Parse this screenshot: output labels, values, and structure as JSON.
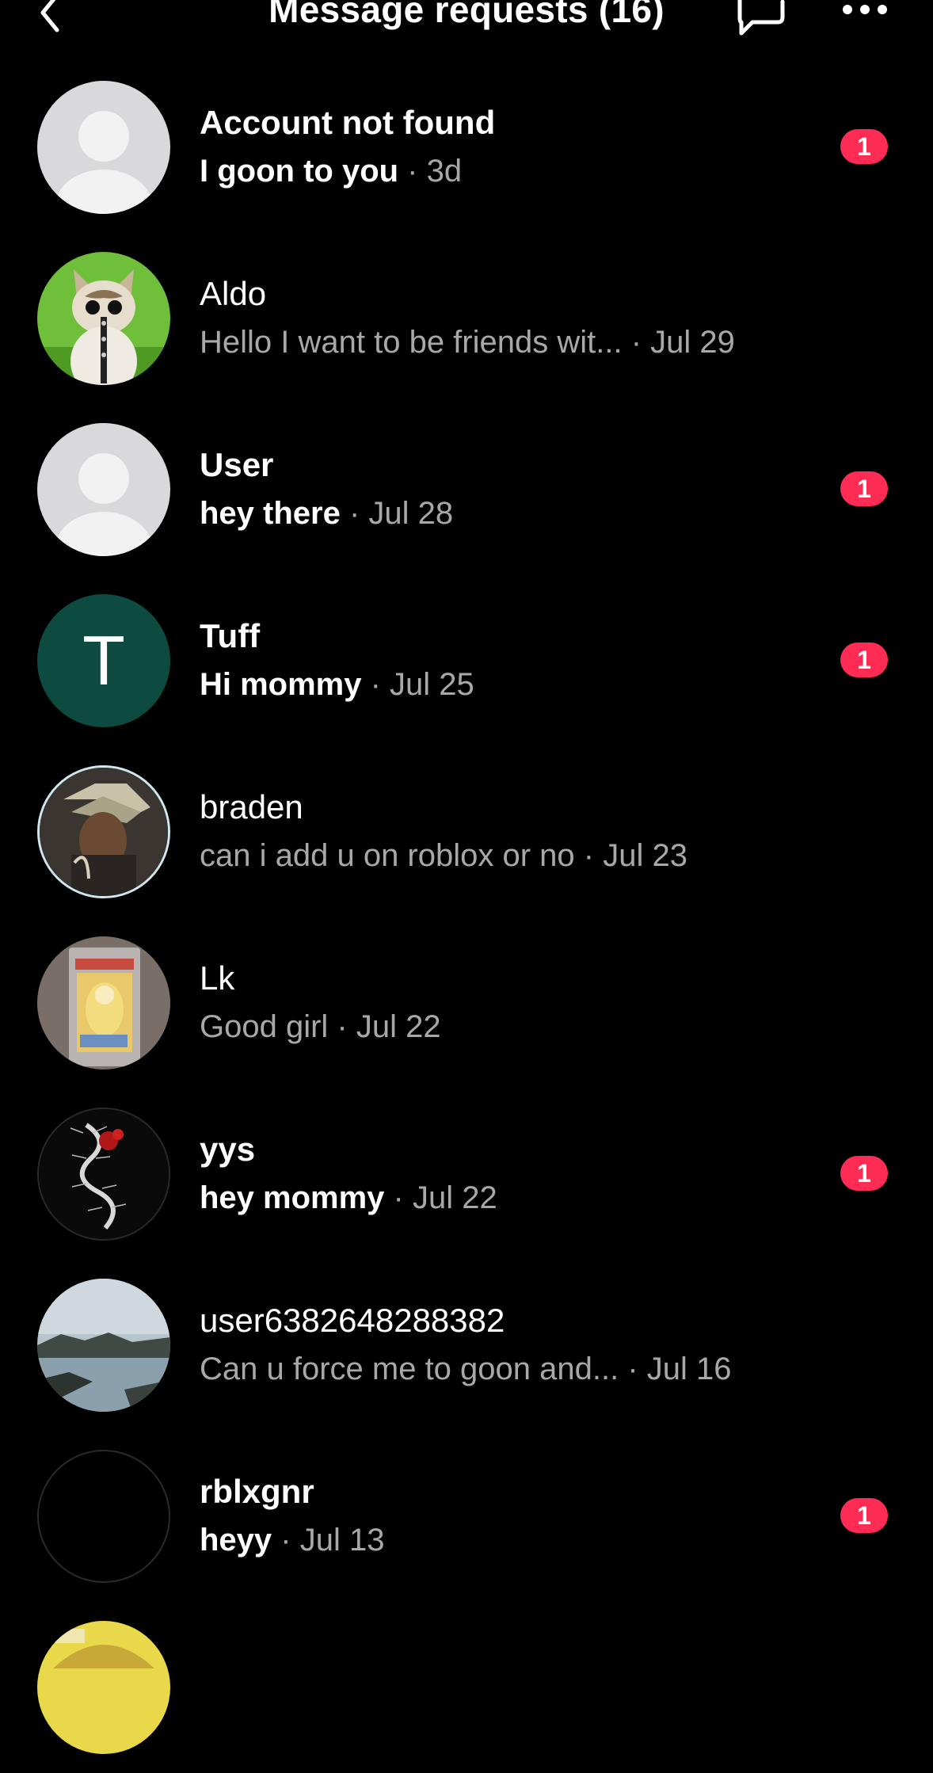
{
  "header": {
    "title": "Message requests (16)",
    "back_icon": "chevron-left-icon",
    "compose_icon": "compose-bubble-icon",
    "more_icon": "more-dots-icon"
  },
  "colors": {
    "background": "#000000",
    "badge": "#fe2c55",
    "secondary_text": "#a8a8a8"
  },
  "requests": [
    {
      "name": "Account not found",
      "message": "I goon to you",
      "time": "3d",
      "unread": true,
      "badge": "1",
      "avatar": "default-avatar"
    },
    {
      "name": "Aldo",
      "message": "Hello I want to be friends wit...",
      "time": "Jul 29",
      "unread": false,
      "badge": "",
      "avatar": "cat-photo"
    },
    {
      "name": "User",
      "message": "hey there",
      "time": "Jul 28",
      "unread": true,
      "badge": "1",
      "avatar": "default-avatar"
    },
    {
      "name": "Tuff",
      "message": "Hi mommy",
      "time": "Jul 25",
      "unread": true,
      "badge": "1",
      "avatar": "letter-avatar",
      "initial": "T"
    },
    {
      "name": "braden",
      "message": "can i add u on roblox or no",
      "time": "Jul 23",
      "unread": false,
      "badge": "",
      "avatar": "money-photo"
    },
    {
      "name": "Lk",
      "message": "Good girl",
      "time": "Jul 22",
      "unread": false,
      "badge": "",
      "avatar": "card-photo"
    },
    {
      "name": "yys",
      "message": "hey mommy",
      "time": "Jul 22",
      "unread": true,
      "badge": "1",
      "avatar": "centipede-photo"
    },
    {
      "name": "user6382648288382",
      "message": "Can u force me to goon and...",
      "time": "Jul 16",
      "unread": false,
      "badge": "",
      "avatar": "coast-photo"
    },
    {
      "name": "rblxgnr",
      "message": "heyy",
      "time": "Jul 13",
      "unread": true,
      "badge": "1",
      "avatar": "black-avatar"
    },
    {
      "name": "",
      "message": "",
      "time": "",
      "unread": false,
      "badge": "",
      "avatar": "yellow-photo"
    }
  ]
}
